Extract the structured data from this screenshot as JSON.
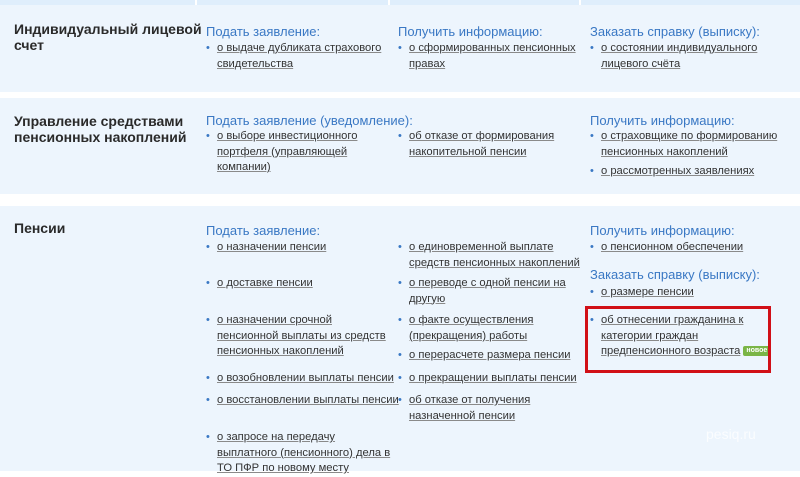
{
  "rows": [
    {
      "title_line1": "Индивидуальный лицевой",
      "title_line2": "счет",
      "col1": {
        "heading": "Подать заявление:",
        "items": [
          {
            "line1": "о выдаче дубликата страхового",
            "line2": "свидетельства"
          }
        ]
      },
      "col2": {
        "heading": "Получить информацию:",
        "items": [
          {
            "line1": "о сформированных пенсионных",
            "line2": "правах"
          }
        ]
      },
      "col3": {
        "heading": "Заказать справку (выписку):",
        "items": [
          {
            "line1": "о состоянии индивидуального",
            "line2": "лицевого счёта"
          }
        ]
      }
    },
    {
      "title_line1": "Управление средствами",
      "title_line2": "пенсионных накоплений",
      "col1": {
        "heading": "Подать заявление (уведомление):",
        "items": [
          {
            "line1": "о выборе инвестиционного",
            "line2": "портфеля (управляющей",
            "line3": "компании)"
          }
        ]
      },
      "col2": {
        "items": [
          {
            "line1": "об отказе от формирования",
            "line2": "накопительной пенсии"
          }
        ]
      },
      "col3": {
        "heading": "Получить информацию:",
        "items": [
          {
            "line1": "о страховщике по формированию",
            "line2": "пенсионных накоплений"
          },
          {
            "line1": "о рассмотренных заявлениях"
          }
        ]
      }
    },
    {
      "title_line1": "Пенсии",
      "col1": {
        "heading": "Подать заявление:",
        "items": [
          {
            "line1": "о назначении пенсии"
          },
          {
            "line1": "о доставке пенсии"
          },
          {
            "line1": "о назначении срочной",
            "line2": "пенсионной выплаты из средств",
            "line3": "пенсионных накоплений"
          },
          {
            "line1": "о возобновлении выплаты пенсии"
          },
          {
            "line1": "о восстановлении выплаты пенсии"
          },
          {
            "line1": "о запросе на передачу",
            "line2": "выплатного (пенсионного) дела в",
            "line3": "ТО ПФР по новому месту"
          }
        ]
      },
      "col2": {
        "items": [
          {
            "line1": "о единовременной выплате",
            "line2": "средств пенсионных накоплений"
          },
          {
            "line1": "о переводе с одной пенсии на",
            "line2": "другую"
          },
          {
            "line1": "о факте осуществления",
            "line2": "(прекращения) работы"
          },
          {
            "line1": "о перерасчете размера пенсии"
          },
          {
            "line1": "о прекращении выплаты пенсии"
          },
          {
            "line1": "об отказе от получения",
            "line2": "назначенной пенсии"
          }
        ]
      },
      "col3": {
        "heading": "Получить информацию:",
        "items": [
          {
            "line1": "о пенсионном обеспечении"
          }
        ],
        "heading2": "Заказать справку (выписку):",
        "items2": [
          {
            "line1": "о размере пенсии"
          },
          {
            "line1": "об отнесении гражданина к",
            "line2": "категории граждан",
            "line3": "предпенсионного возраста",
            "badge": "новое"
          }
        ]
      }
    }
  ],
  "bullet_glyph": "•",
  "watermark": "pesiq.ru",
  "colors": {
    "link_blue": "#3a78c4",
    "band": "#edf5fd",
    "highlight_red": "#d10f17",
    "badge_green": "#7ab546"
  }
}
